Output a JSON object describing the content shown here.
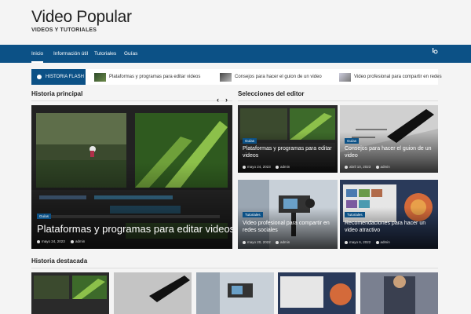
{
  "site": {
    "title": "Video Popular",
    "tagline": "VIDEOS Y TUTORIALES"
  },
  "nav": {
    "items": [
      "Inicio",
      "Información útil",
      "Tutoriales",
      "Guías"
    ],
    "active": "Inicio",
    "right_icon": "search-icon"
  },
  "ticker": {
    "label": "HISTORIA FLASH",
    "items": [
      "Plataformas y programas para editar videos",
      "Consejos para hacer el guion de un video",
      "Video profesional para compartir en redes"
    ]
  },
  "main_story": {
    "heading": "Historia principal",
    "tag": "Guías",
    "title": "Plataformas y programas para editar videos",
    "date": "mayo 24, 2023",
    "author": "admin",
    "prev_icon": "chevron-left-icon",
    "next_icon": "chevron-right-icon"
  },
  "editor": {
    "heading": "Selecciones del editor",
    "cards": [
      {
        "tag": "Guías",
        "title": "Plataformas y programas para editar videos",
        "date": "mayo 24, 2023",
        "author": "admin"
      },
      {
        "tag": "Guías",
        "title": "Consejos para hacer el guion de un video",
        "date": "abril 10, 2023",
        "author": "admin"
      },
      {
        "tag": "Tutoriales",
        "title": "Video profesional para compartir en redes sociales",
        "date": "mayo 20, 2022",
        "author": "admin"
      },
      {
        "tag": "Tutoriales",
        "title": "Recomendaciones para hacer un video atractivo",
        "date": "mayo 6, 2022",
        "author": "admin"
      }
    ]
  },
  "featured": {
    "heading": "Historia destacada"
  },
  "colors": {
    "brand": "#0c5186",
    "background": "#f4f4f4"
  }
}
